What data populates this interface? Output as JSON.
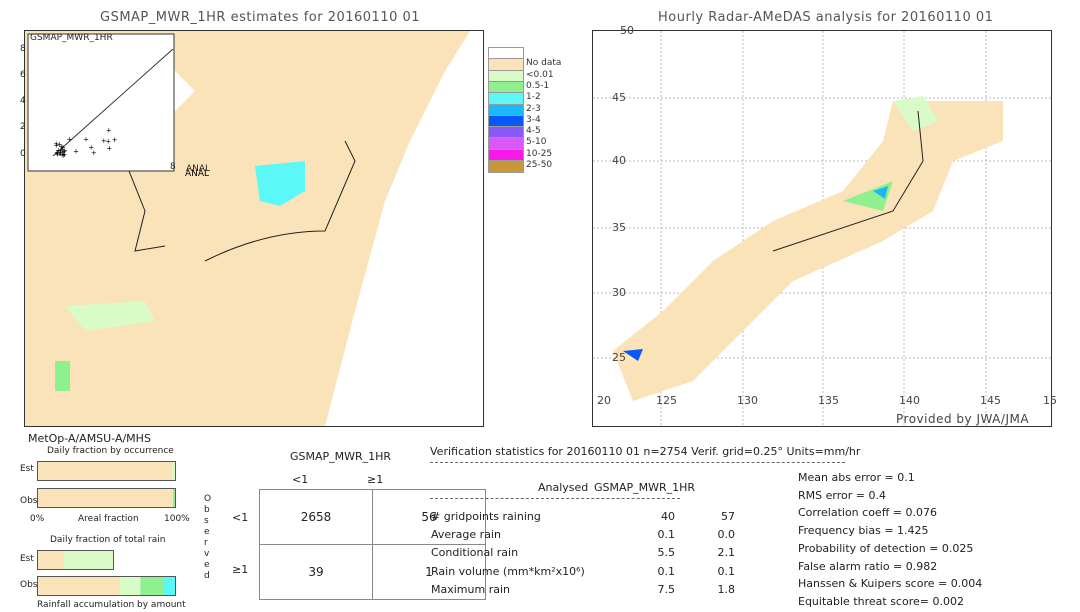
{
  "left_map": {
    "title": "GSMAP_MWR_1HR estimates for 20160110 01",
    "inset_title": "GSMAP_MWR_1HR",
    "inset_xlabel": "ANAL",
    "inset_ticks": [
      "0",
      "2",
      "4",
      "6",
      "8"
    ]
  },
  "right_map": {
    "title": "Hourly Radar-AMeDAS analysis for 20160110 01",
    "credit": "Provided by JWA/JMA",
    "lat_labels": [
      "50",
      "45",
      "40",
      "35",
      "30",
      "25"
    ],
    "lon_labels": [
      "20",
      "125",
      "130",
      "135",
      "140",
      "145",
      "15"
    ]
  },
  "legend": {
    "items": [
      {
        "label": "",
        "color": "#ffffff"
      },
      {
        "label": "No data",
        "color": "#fae3b8"
      },
      {
        "label": "<0.01",
        "color": "#d8fbc8"
      },
      {
        "label": "0.5-1",
        "color": "#8ef08e"
      },
      {
        "label": "1-2",
        "color": "#5cf8f8"
      },
      {
        "label": "2-3",
        "color": "#1cb8f8"
      },
      {
        "label": "3-4",
        "color": "#0858f8"
      },
      {
        "label": "4-5",
        "color": "#8858f8"
      },
      {
        "label": "5-10",
        "color": "#d858f8"
      },
      {
        "label": "10-25",
        "color": "#f818e8"
      },
      {
        "label": "25-50",
        "color": "#c89838"
      }
    ]
  },
  "fraction": {
    "satellite": "MetOp-A/AMSU-A/MHS",
    "occurrence_title": "Daily fraction by occurrence",
    "est": "Est",
    "obs": "Obs",
    "axis_left": "0%",
    "axis_mid": "Areal fraction",
    "axis_right": "100%",
    "total_rain_title": "Daily fraction of total rain",
    "accum_title": "Rainfall accumulation by amount"
  },
  "contingency": {
    "title": "GSMAP_MWR_1HR",
    "col_headers": [
      "<1",
      "≥1"
    ],
    "row_headers": [
      "<1",
      "≥1"
    ],
    "side_label": [
      "O",
      "b",
      "s",
      "e",
      "r",
      "v",
      "e",
      "d"
    ],
    "cells": [
      [
        "2658",
        "56"
      ],
      [
        "39",
        "1"
      ]
    ]
  },
  "stats": {
    "header": "Verification statistics for 20160110 01   n=2754   Verif. grid=0.25°   Units=mm/hr",
    "col_analysed": "Analysed",
    "col_est": "GSMAP_MWR_1HR",
    "rows": [
      {
        "label": "# gridpoints raining",
        "a": "40",
        "e": "57"
      },
      {
        "label": "Average rain",
        "a": "0.1",
        "e": "0.0"
      },
      {
        "label": "Conditional rain",
        "a": "5.5",
        "e": "2.1"
      },
      {
        "label": "Rain volume (mm*km²x10⁶)",
        "a": "0.1",
        "e": "0.1"
      },
      {
        "label": "Maximum rain",
        "a": "7.5",
        "e": "1.8"
      }
    ],
    "scores": [
      "Mean abs error = 0.1",
      "RMS error = 0.4",
      "Correlation coeff = 0.076",
      "Frequency bias = 1.425",
      "Probability of detection = 0.025",
      "False alarm ratio = 0.982",
      "Hanssen & Kuipers score = 0.004",
      "Equitable threat score= 0.002"
    ]
  },
  "chart_data": {
    "type": "table",
    "contingency": [
      [
        2658,
        56
      ],
      [
        39,
        1
      ]
    ],
    "n": 2754
  }
}
